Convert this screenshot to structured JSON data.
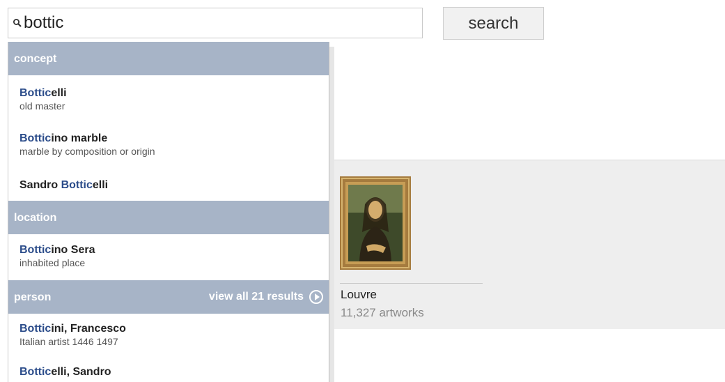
{
  "search": {
    "value": "bottic",
    "button_label": "search"
  },
  "dropdown": {
    "groups": [
      {
        "label": "concept",
        "items": [
          {
            "match": "Bottic",
            "rest": "elli",
            "subtitle": "old master"
          },
          {
            "match": "Bottic",
            "rest": "ino marble",
            "subtitle": "marble by composition or origin"
          },
          {
            "prefix": "Sandro ",
            "match": "Bottic",
            "rest": "elli"
          }
        ]
      },
      {
        "label": "location",
        "items": [
          {
            "match": "Bottic",
            "rest": "ino Sera",
            "subtitle": "inhabited place"
          }
        ]
      },
      {
        "label": "person",
        "view_all": "view all 21 results",
        "items": [
          {
            "match": "Bottic",
            "rest": "ini, Francesco",
            "subtitle": "Italian artist 1446 1497"
          },
          {
            "match": "Bottic",
            "rest": "elli, Sandro"
          }
        ]
      }
    ]
  },
  "card": {
    "title": "Louvre",
    "subtitle": "11,327 artworks",
    "image": "mona-lisa-painting"
  },
  "colors": {
    "group_header_bg": "#a7b4c7",
    "highlight": "#2b4c8a"
  }
}
